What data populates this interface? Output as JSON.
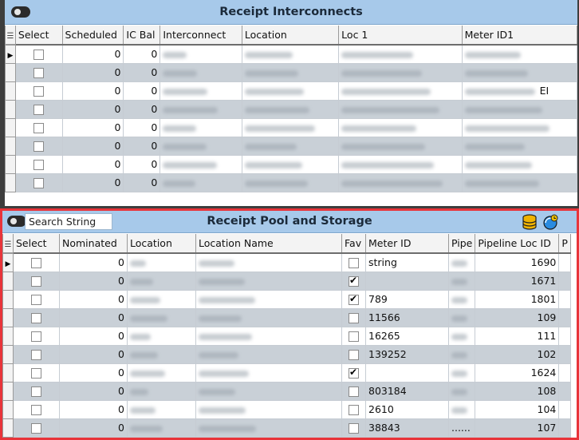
{
  "panel1": {
    "title": "Receipt Interconnects",
    "columns": [
      "Select",
      "Scheduled",
      "IC Bal",
      "Interconnect",
      "Location",
      "Loc 1",
      "Meter ID1"
    ],
    "rows": [
      {
        "scheduled": "0",
        "ic_bal": "0",
        "extra": ""
      },
      {
        "scheduled": "0",
        "ic_bal": "0",
        "extra": ""
      },
      {
        "scheduled": "0",
        "ic_bal": "0",
        "extra": "EI"
      },
      {
        "scheduled": "0",
        "ic_bal": "0",
        "extra": ""
      },
      {
        "scheduled": "0",
        "ic_bal": "0",
        "extra": ""
      },
      {
        "scheduled": "0",
        "ic_bal": "0",
        "extra": ""
      },
      {
        "scheduled": "0",
        "ic_bal": "0",
        "extra": ""
      },
      {
        "scheduled": "0",
        "ic_bal": "0",
        "extra": ""
      }
    ]
  },
  "panel2": {
    "title": "Receipt Pool and Storage",
    "search_placeholder": "Search String",
    "columns": [
      "Select",
      "Nominated",
      "Location",
      "Location Name",
      "Fav",
      "Meter ID",
      "Pipe",
      "Pipeline Loc ID",
      "P"
    ],
    "rows": [
      {
        "nominated": "0",
        "fav": false,
        "meter_id": "string",
        "pipe": "",
        "loc_id": "1690"
      },
      {
        "nominated": "0",
        "fav": true,
        "meter_id": "",
        "pipe": "",
        "loc_id": "1671"
      },
      {
        "nominated": "0",
        "fav": true,
        "meter_id": "789",
        "pipe": "",
        "loc_id": "1801"
      },
      {
        "nominated": "0",
        "fav": false,
        "meter_id": "11566",
        "pipe": "",
        "loc_id": "109"
      },
      {
        "nominated": "0",
        "fav": false,
        "meter_id": "16265",
        "pipe": "",
        "loc_id": "111"
      },
      {
        "nominated": "0",
        "fav": false,
        "meter_id": "139252",
        "pipe": "",
        "loc_id": "102"
      },
      {
        "nominated": "0",
        "fav": true,
        "meter_id": "",
        "pipe": "",
        "loc_id": "1624"
      },
      {
        "nominated": "0",
        "fav": false,
        "meter_id": "803184",
        "pipe": "",
        "loc_id": "108"
      },
      {
        "nominated": "0",
        "fav": false,
        "meter_id": "2610",
        "pipe": "",
        "loc_id": "104"
      },
      {
        "nominated": "0",
        "fav": false,
        "meter_id": "38843",
        "pipe": "......",
        "loc_id": "107"
      }
    ]
  },
  "icons": {
    "toggle": "toggle-switch-icon",
    "db": "database-icon",
    "refresh": "refresh-globe-icon",
    "current_row": "current-row-triangle-icon",
    "grid_menu": "grid-menu-icon"
  },
  "colors": {
    "titlebar": "#a7c9ea",
    "alt_row": "#c9d0d7",
    "highlight_border": "#e8343a"
  }
}
